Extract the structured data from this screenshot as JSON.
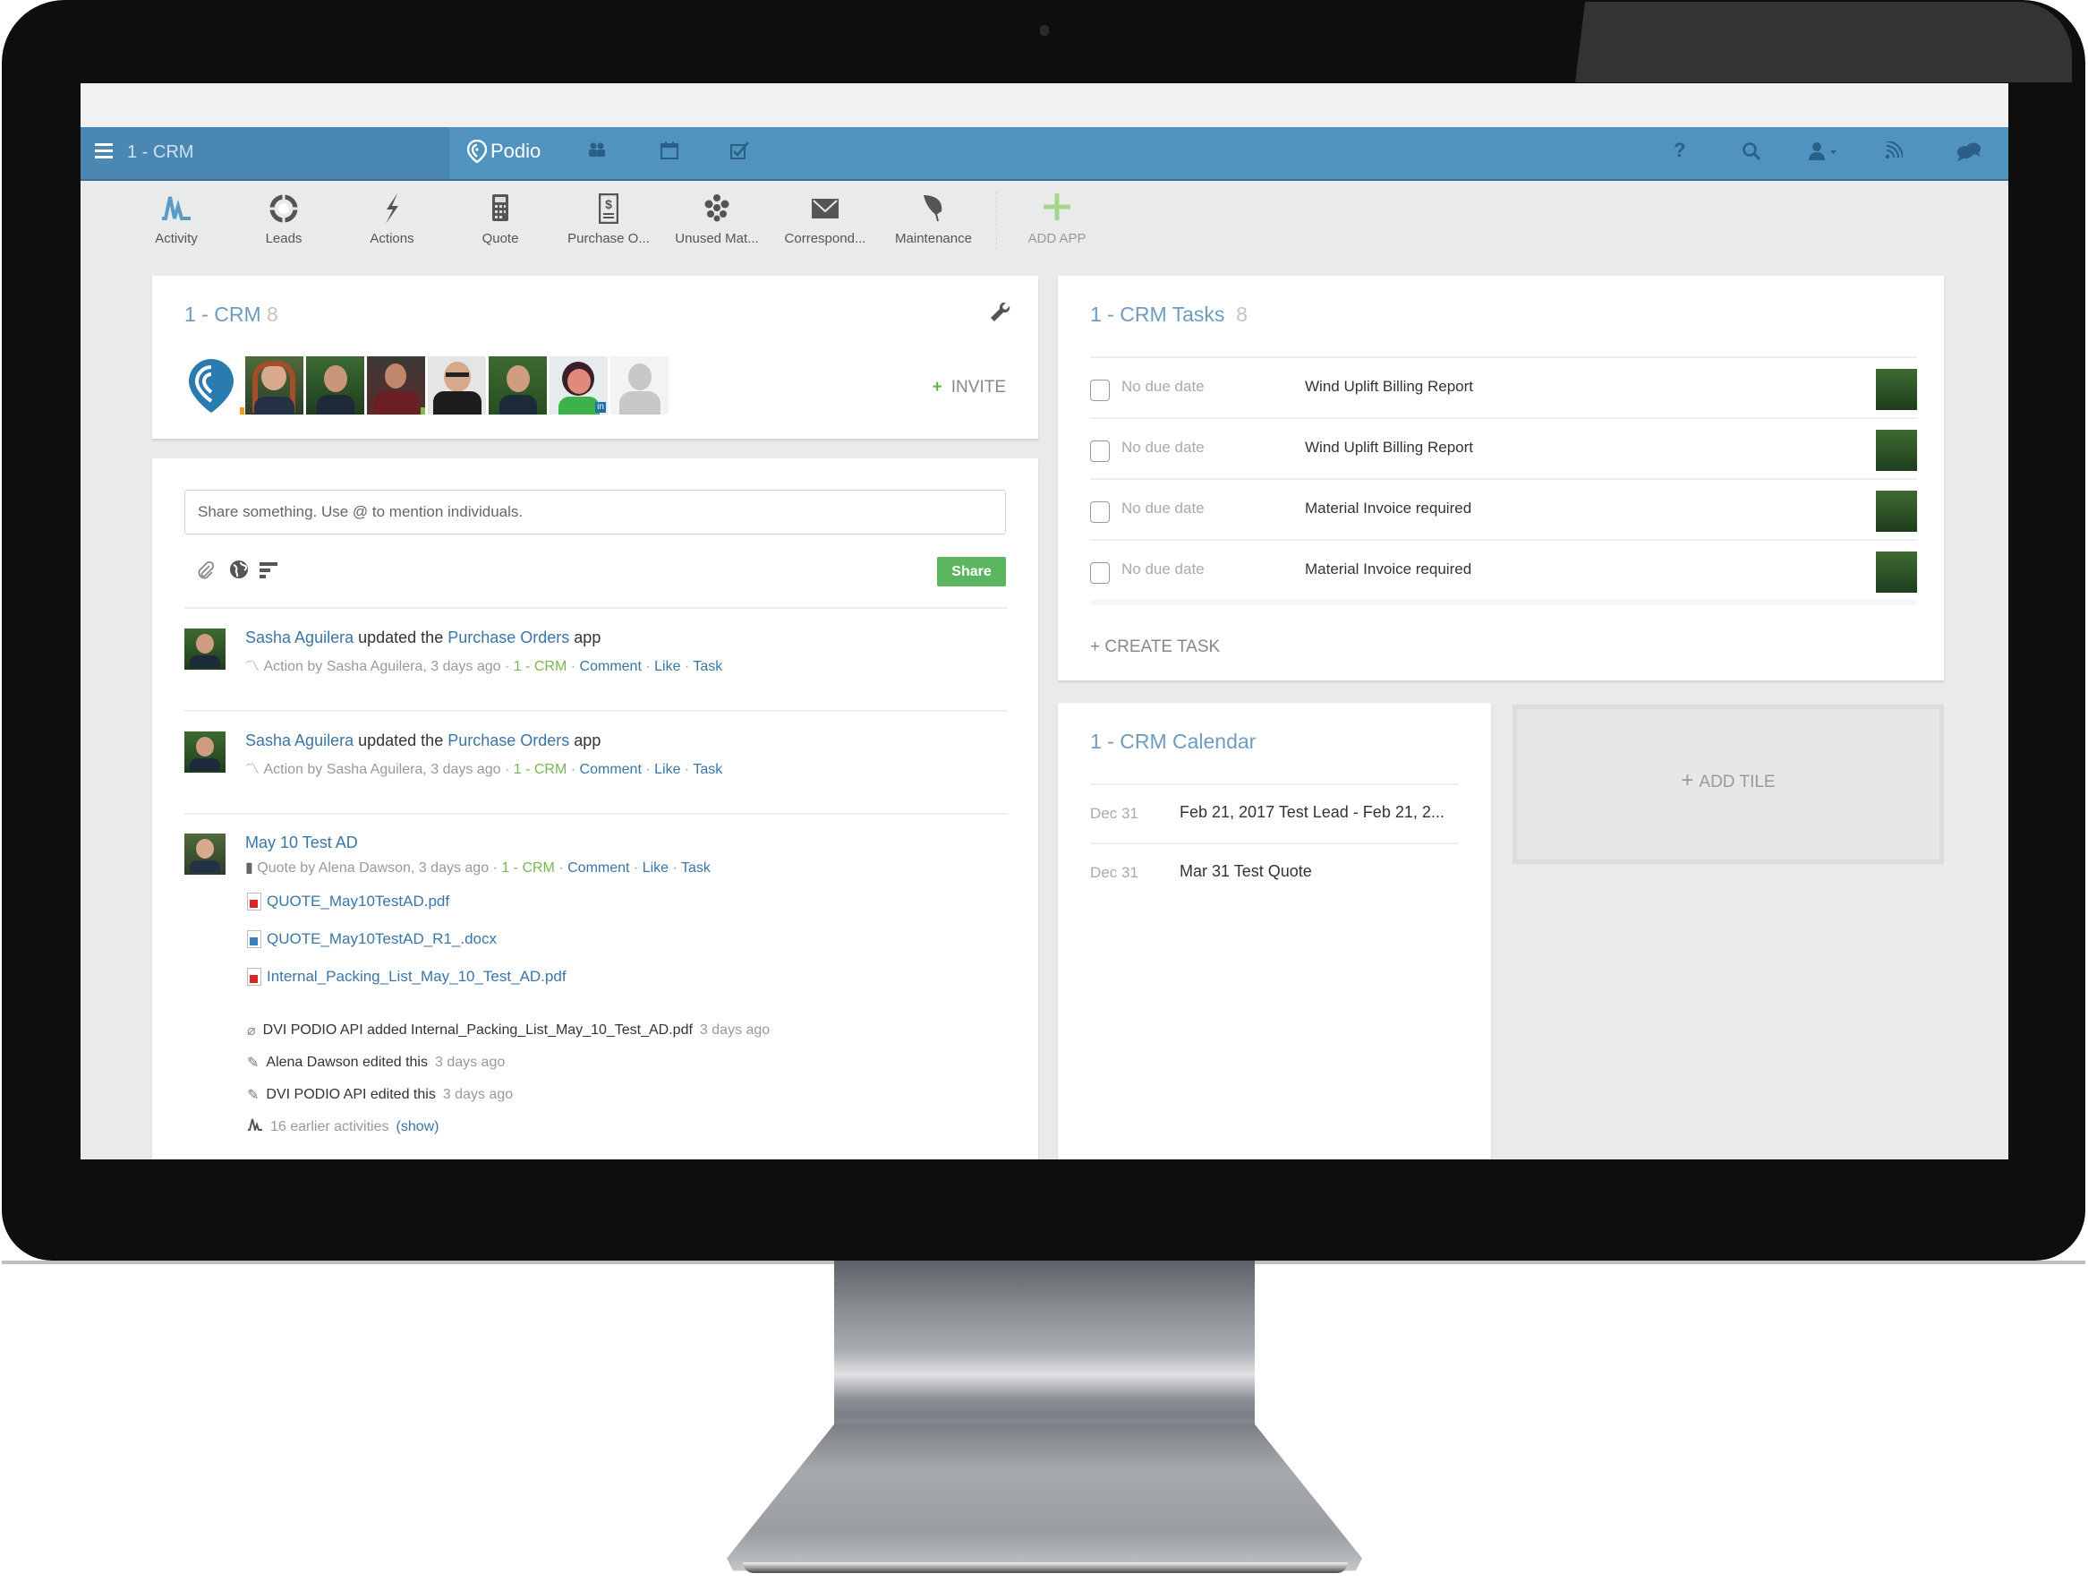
{
  "window": {
    "workspace_name": "1 - CRM",
    "brand": "Podio"
  },
  "nav": {
    "left_icons": [
      "contacts-icon",
      "calendar-icon",
      "tasks-icon"
    ],
    "right_icons": [
      "help-icon",
      "search-icon",
      "user-menu-icon",
      "activity-stream-icon",
      "chat-icon"
    ]
  },
  "apps": [
    {
      "label": "Activity",
      "icon": "activity-icon"
    },
    {
      "label": "Leads",
      "icon": "lifebuoy-icon"
    },
    {
      "label": "Actions",
      "icon": "lightning-icon"
    },
    {
      "label": "Quote",
      "icon": "calculator-icon"
    },
    {
      "label": "Purchase O...",
      "icon": "invoice-icon"
    },
    {
      "label": "Unused Mat...",
      "icon": "cluster-icon"
    },
    {
      "label": "Correspond...",
      "icon": "envelope-icon"
    },
    {
      "label": "Maintenance",
      "icon": "leaf-icon"
    }
  ],
  "add_app_label": "ADD APP",
  "members_panel": {
    "title": "1 - CRM",
    "count": "8",
    "invite_label": "INVITE",
    "members": [
      "member-1",
      "member-2",
      "member-3",
      "member-4",
      "member-5",
      "member-6",
      "member-7",
      "member-8"
    ]
  },
  "share": {
    "placeholder": "Share something. Use @ to mention individuals.",
    "button_label": "Share"
  },
  "feed": [
    {
      "actor": "Sasha Aguilera",
      "verb": "updated the",
      "object": "Purchase Orders",
      "suffix": "app",
      "meta": "Action by Sasha Aguilera, 3 days ago",
      "workspace": "1 - CRM",
      "comment": "Comment",
      "like": "Like",
      "task": "Task"
    },
    {
      "actor": "Sasha Aguilera",
      "verb": "updated the",
      "object": "Purchase Orders",
      "suffix": "app",
      "meta": "Action by Sasha Aguilera, 3 days ago",
      "workspace": "1 - CRM",
      "comment": "Comment",
      "like": "Like",
      "task": "Task"
    },
    {
      "title": "May 10 Test AD",
      "meta": "Quote by Alena Dawson, 3 days ago",
      "workspace": "1 - CRM",
      "comment": "Comment",
      "like": "Like",
      "task": "Task",
      "files": [
        {
          "name": "QUOTE_May10TestAD.pdf",
          "type": "pdf"
        },
        {
          "name": "QUOTE_May10TestAD_R1_.docx",
          "type": "docx"
        },
        {
          "name": "Internal_Packing_List_May_10_Test_AD.pdf",
          "type": "pdf"
        }
      ],
      "activities": [
        {
          "text": "DVI PODIO API added Internal_Packing_List_May_10_Test_AD.pdf",
          "time": "3 days ago",
          "icon": "paperclip-icon"
        },
        {
          "text": "Alena Dawson edited this",
          "time": "3 days ago",
          "icon": "pencil-icon"
        },
        {
          "text": "DVI PODIO API edited this",
          "time": "3 days ago",
          "icon": "pencil-icon"
        }
      ],
      "earlier": {
        "text": "16 earlier activities",
        "show": "(show)"
      }
    }
  ],
  "tasks_panel": {
    "title": "1 - CRM Tasks",
    "count": "8",
    "tasks": [
      {
        "due": "No due date",
        "name": "Wind Uplift Billing Report"
      },
      {
        "due": "No due date",
        "name": "Wind Uplift Billing Report"
      },
      {
        "due": "No due date",
        "name": "Material Invoice required"
      },
      {
        "due": "No due date",
        "name": "Material Invoice required"
      }
    ],
    "create_label": "+ CREATE TASK"
  },
  "calendar_panel": {
    "title": "1 - CRM Calendar",
    "events": [
      {
        "date": "Dec 31",
        "title": "Feb 21, 2017 Test Lead - Feb 21, 2..."
      },
      {
        "date": "Dec 31",
        "title": "Mar 31 Test Quote"
      }
    ]
  },
  "add_tile_label": "ADD TILE",
  "colors": {
    "nav": "#5093be",
    "accent_green": "#5bb55f",
    "link": "#3a75a8"
  }
}
